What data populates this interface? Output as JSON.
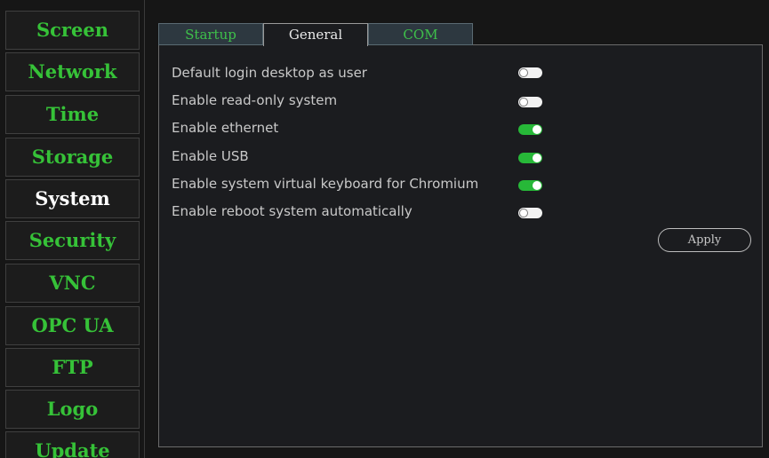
{
  "sidebar": {
    "items": [
      {
        "label": "Screen",
        "active": false
      },
      {
        "label": "Network",
        "active": false
      },
      {
        "label": "Time",
        "active": false
      },
      {
        "label": "Storage",
        "active": false
      },
      {
        "label": "System",
        "active": true
      },
      {
        "label": "Security",
        "active": false
      },
      {
        "label": "VNC",
        "active": false
      },
      {
        "label": "OPC UA",
        "active": false
      },
      {
        "label": "FTP",
        "active": false
      },
      {
        "label": "Logo",
        "active": false
      },
      {
        "label": "Update",
        "active": false
      }
    ]
  },
  "tabs": [
    {
      "label": "Startup",
      "active": false
    },
    {
      "label": "General",
      "active": true
    },
    {
      "label": "COM",
      "active": false
    }
  ],
  "settings": [
    {
      "label": "Default login desktop as user",
      "enabled": false
    },
    {
      "label": "Enable read-only system",
      "enabled": false
    },
    {
      "label": "Enable ethernet",
      "enabled": true
    },
    {
      "label": "Enable USB",
      "enabled": true
    },
    {
      "label": "Enable system virtual keyboard for Chromium",
      "enabled": true
    },
    {
      "label": "Enable reboot system automatically",
      "enabled": false
    }
  ],
  "actions": {
    "apply_label": "Apply"
  },
  "colors": {
    "accent_green": "#36c238",
    "toggle_on": "#27b838",
    "toggle_off": "#f2f2f2",
    "background": "#161616",
    "panel": "#1b1c1f"
  }
}
